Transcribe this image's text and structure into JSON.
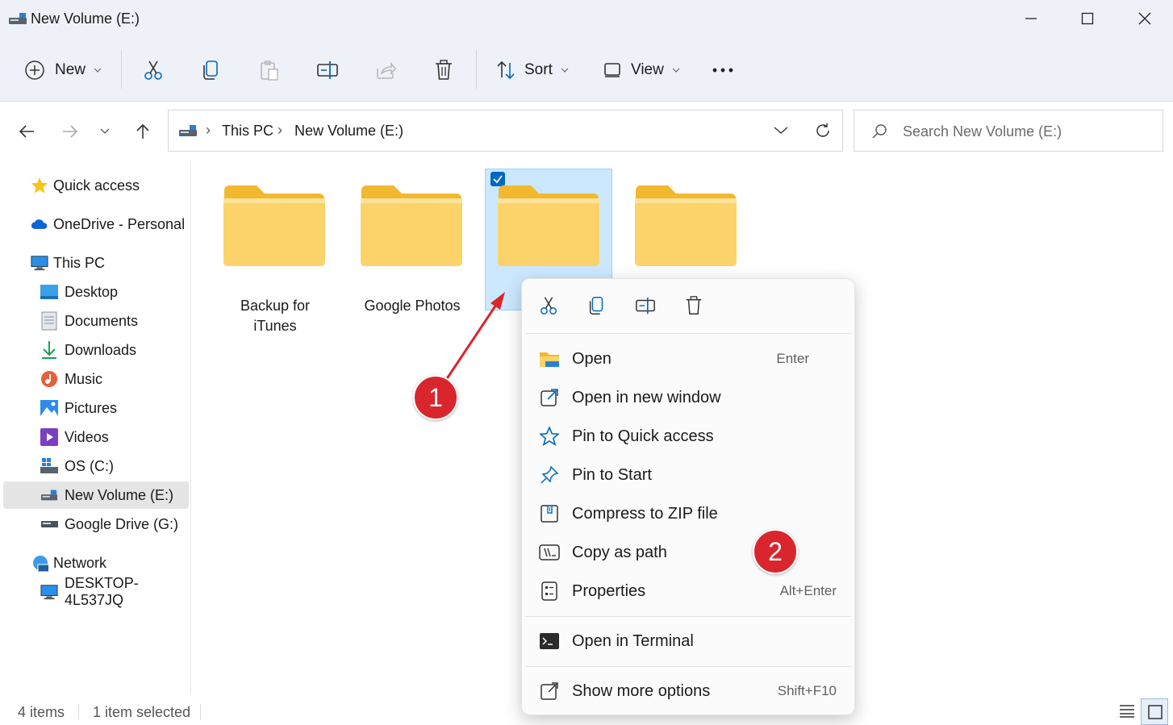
{
  "window": {
    "title": "New Volume (E:)",
    "minimize_icon": "minimize-icon",
    "maximize_icon": "maximize-icon",
    "close_icon": "close-icon"
  },
  "toolbar": {
    "new_label": "New",
    "sort_label": "Sort",
    "view_label": "View"
  },
  "address": {
    "segments": [
      "This PC",
      "New Volume (E:)"
    ]
  },
  "search": {
    "placeholder": "Search New Volume (E:)"
  },
  "sidebar": {
    "quick_access": "Quick access",
    "onedrive": "OneDrive - Personal",
    "this_pc": "This PC",
    "items": [
      "Desktop",
      "Documents",
      "Downloads",
      "Music",
      "Pictures",
      "Videos",
      "OS (C:)",
      "New Volume (E:)",
      "Google Drive (G:)"
    ],
    "network": "Network",
    "network_items": [
      "DESKTOP-4L537JQ"
    ]
  },
  "folders": [
    {
      "name_line1": "Backup for",
      "name_line2": "iTunes"
    },
    {
      "name_line1": "Google Photos",
      "name_line2": ""
    },
    {
      "name_line1": "",
      "name_line2": ""
    },
    {
      "name_line1": "",
      "name_line2": ""
    }
  ],
  "status": {
    "items": "4 items",
    "selected": "1 item selected"
  },
  "context_menu": {
    "items": [
      {
        "label": "Open",
        "shortcut": "Enter"
      },
      {
        "label": "Open in new window",
        "shortcut": ""
      },
      {
        "label": "Pin to Quick access",
        "shortcut": ""
      },
      {
        "label": "Pin to Start",
        "shortcut": ""
      },
      {
        "label": "Compress to ZIP file",
        "shortcut": ""
      },
      {
        "label": "Copy as path",
        "shortcut": ""
      },
      {
        "label": "Properties",
        "shortcut": "Alt+Enter"
      },
      {
        "label": "Open in Terminal",
        "shortcut": ""
      },
      {
        "label": "Show more options",
        "shortcut": "Shift+F10"
      }
    ]
  },
  "annotations": {
    "badge1": "1",
    "badge2": "2"
  },
  "colors": {
    "accent": "#0067c0",
    "folder": "#f7c948",
    "badge": "#d9262d",
    "selection": "#cce8ff"
  }
}
